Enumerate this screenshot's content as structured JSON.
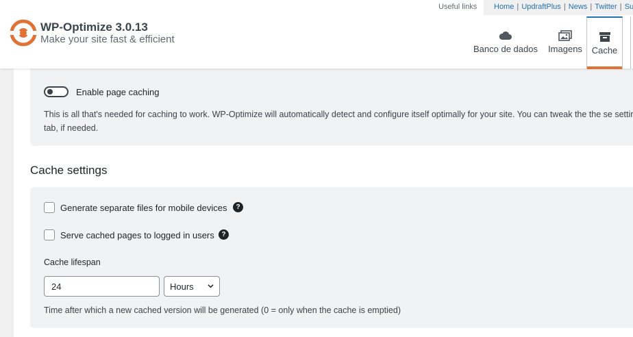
{
  "header": {
    "title": "WP-Optimize 3.0.13",
    "tagline": "Make your site fast & efficient",
    "useful_links_label": "Useful links",
    "links": [
      "Home",
      "UpdraftPlus",
      "News",
      "Twitter",
      "Sup"
    ]
  },
  "tabs": [
    {
      "label": "Banco de dados",
      "icon": "cloud-database-icon"
    },
    {
      "label": "Imagens",
      "icon": "images-icon"
    },
    {
      "label": "Cache",
      "icon": "archive-box-icon",
      "active": true
    }
  ],
  "caching": {
    "toggle_label": "Enable page caching",
    "toggle_on": false,
    "description": "This is all that's needed for caching to work. WP-Optimize will automatically detect and configure itself optimally for your site. You can tweak the the se settings tab, if needed."
  },
  "cache_settings": {
    "title": "Cache settings",
    "mobile_label": "Generate separate files for mobile devices",
    "mobile_checked": false,
    "logged_in_label": "Serve cached pages to logged in users",
    "logged_in_checked": false,
    "help_glyph": "?",
    "lifespan_label": "Cache lifespan",
    "lifespan_value": "24",
    "lifespan_unit": "Hours",
    "lifespan_hint": "Time after which a new cached version will be generated (0 = only when the cache is emptied)"
  },
  "colors": {
    "accent": "#e07236",
    "link": "#2271b1",
    "panel": "#f1f2f3"
  }
}
